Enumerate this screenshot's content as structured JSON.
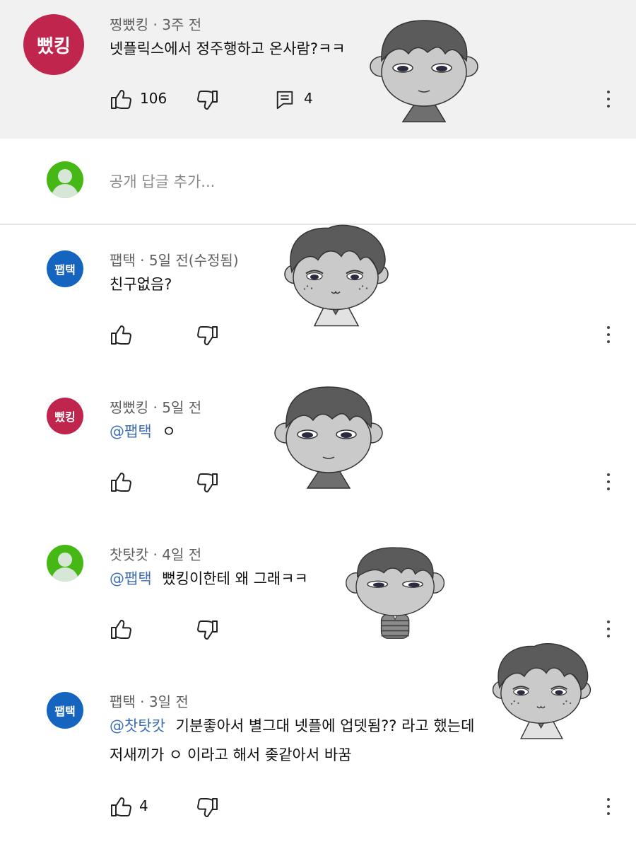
{
  "top_comment": {
    "avatar_text": "뻤킹",
    "meta": "찡뻤킹 · 3주 전",
    "text": "넷플릭스에서 정주행하고 온사람?ㅋㅋ",
    "like_count": "106",
    "reply_count": "4"
  },
  "reply_box": {
    "placeholder": "공개 답글 추가..."
  },
  "replies": [
    {
      "avatar_text": "팹택",
      "meta": "팹택 · 5일 전(수정됨)",
      "text": "친구없음?",
      "mention": "",
      "like_count": ""
    },
    {
      "avatar_text": "뻤킹",
      "meta": "찡뻤킹 · 5일 전",
      "mention": "@팹택",
      "text": "ㅇ",
      "like_count": ""
    },
    {
      "avatar_text": "",
      "meta": "찻탓캇 · 4일 전",
      "mention": "@팹택",
      "text": "뻤킹이한테 왜 그래ㅋㅋ",
      "like_count": ""
    },
    {
      "avatar_text": "팹택",
      "meta": "팹택 · 3일 전",
      "mention": "@찻탓캇",
      "text": "기분좋아서 별그대 넷플에 업뎃됨?? 라고 했는데",
      "text2": "저새끼가 ㅇ 이라고 해서 좆같아서 바꿈",
      "like_count": "4"
    }
  ],
  "colors": {
    "red_avatar": "#c0254e",
    "blue_avatar": "#1565c0",
    "green_avatar": "#46b816",
    "mention": "#3e6fb6"
  },
  "icons": [
    "thumb-up-icon",
    "thumb-down-icon",
    "reply-icon",
    "more-vert-icon",
    "default-avatar-icon"
  ]
}
